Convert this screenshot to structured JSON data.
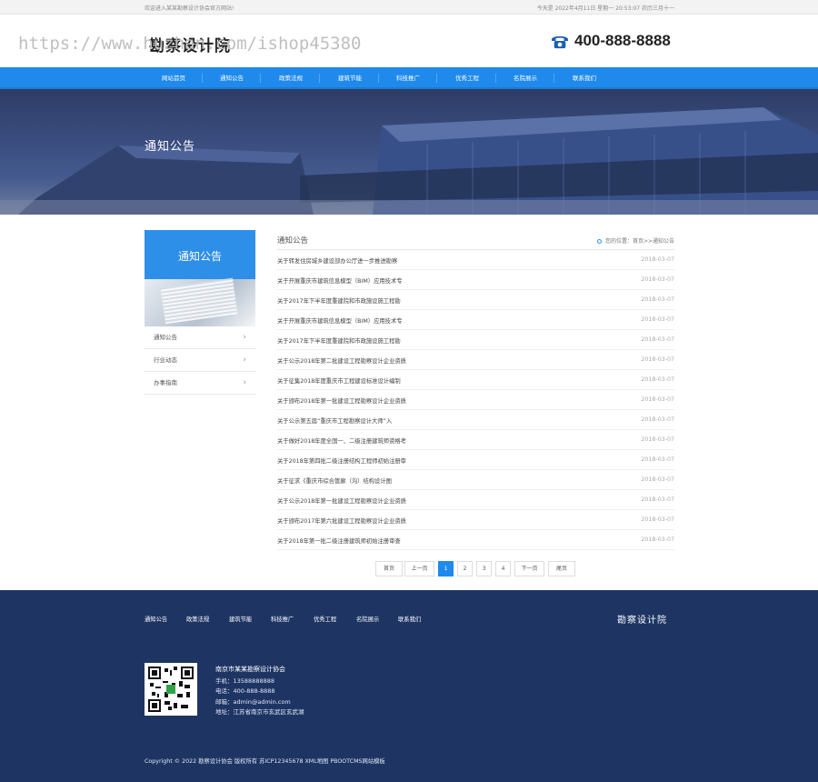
{
  "topbar": {
    "welcome": "欢迎进入某某勘察设计协会官方网站!",
    "datetime": "今天是 2022年4月11日 星期一 20:53:07 农历三月十一"
  },
  "header": {
    "logo_text": "勘察设计院",
    "watermark": "https://www.huzhan.com/ishop45380",
    "phone": "400-888-8888"
  },
  "nav": {
    "items": [
      "网站首页",
      "通知公告",
      "政策法规",
      "建筑节能",
      "科技推广",
      "优秀工程",
      "名院展示",
      "联系我们"
    ]
  },
  "banner": {
    "title": "通知公告"
  },
  "sidebar": {
    "title": "通知公告",
    "items": [
      "通知公告",
      "行业动态",
      "办事指南"
    ]
  },
  "main": {
    "title": "通知公告",
    "breadcrumb": "您的位置：首页>>通知公告",
    "news": [
      {
        "title": "关于转发住房城乡建设部办公厅进一步推进勘察",
        "date": "2018-03-07"
      },
      {
        "title": "关于开展重庆市建筑信息模型（BIM）应用技术专",
        "date": "2018-03-07"
      },
      {
        "title": "关于2017年下半年度重建院和市政施设施工程勘",
        "date": "2018-03-07"
      },
      {
        "title": "关于开展重庆市建筑信息模型（BIM）应用技术专",
        "date": "2018-03-07"
      },
      {
        "title": "关于2017年下半年度重建院和市政施设施工程勘",
        "date": "2018-03-07"
      },
      {
        "title": "关于公示2018年第二批建设工程勘察设计企业资质",
        "date": "2018-03-07"
      },
      {
        "title": "关于征集2018年度重庆市工程建设标准设计编制",
        "date": "2018-03-07"
      },
      {
        "title": "关于颁布2018年第一批建设工程勘察设计企业资质",
        "date": "2018-03-07"
      },
      {
        "title": "关于公示第五届“重庆市工程勘察设计大师”入",
        "date": "2018-03-07"
      },
      {
        "title": "关于做好2018年度全国一、二级注册建筑师资格考",
        "date": "2018-03-07"
      },
      {
        "title": "关于2018年第四批二级注册结构工程师初始注册审",
        "date": "2018-03-07"
      },
      {
        "title": "关于征求《重庆市综合管廊（沟）结构设计图",
        "date": "2018-03-07"
      },
      {
        "title": "关于公示2018年第一批建设工程勘察设计企业资质",
        "date": "2018-03-07"
      },
      {
        "title": "关于颁布2017年第六批建设工程勘察设计企业资质",
        "date": "2018-03-07"
      },
      {
        "title": "关于2018年第一批二级注册建筑师初始注册审查",
        "date": "2018-03-07"
      }
    ]
  },
  "pager": {
    "first": "首页",
    "prev": "上一页",
    "pages": [
      "1",
      "2",
      "3",
      "4"
    ],
    "current": "1",
    "next": "下一页",
    "last": "尾页"
  },
  "footer": {
    "nav": [
      "通知公告",
      "政策法规",
      "建筑节能",
      "科技推广",
      "优秀工程",
      "名院展示",
      "联系我们"
    ],
    "logo_text": "勘察设计院",
    "company": "南京市某某勘察设计协会",
    "mobile": "手机：13588888888",
    "tel": "电话：400-888-8888",
    "email": "邮箱：admin@admin.com",
    "address": "地址：江苏省南京市玄武区玄武湖",
    "copyright": "Copyright © 2022 勘察设计协会 版权所有 苏ICP12345678 XML地图 PBOOTCMS网站模板"
  },
  "colors": {
    "brand_blue": "#1f8aeb",
    "footer_bg": "#1e3564"
  }
}
